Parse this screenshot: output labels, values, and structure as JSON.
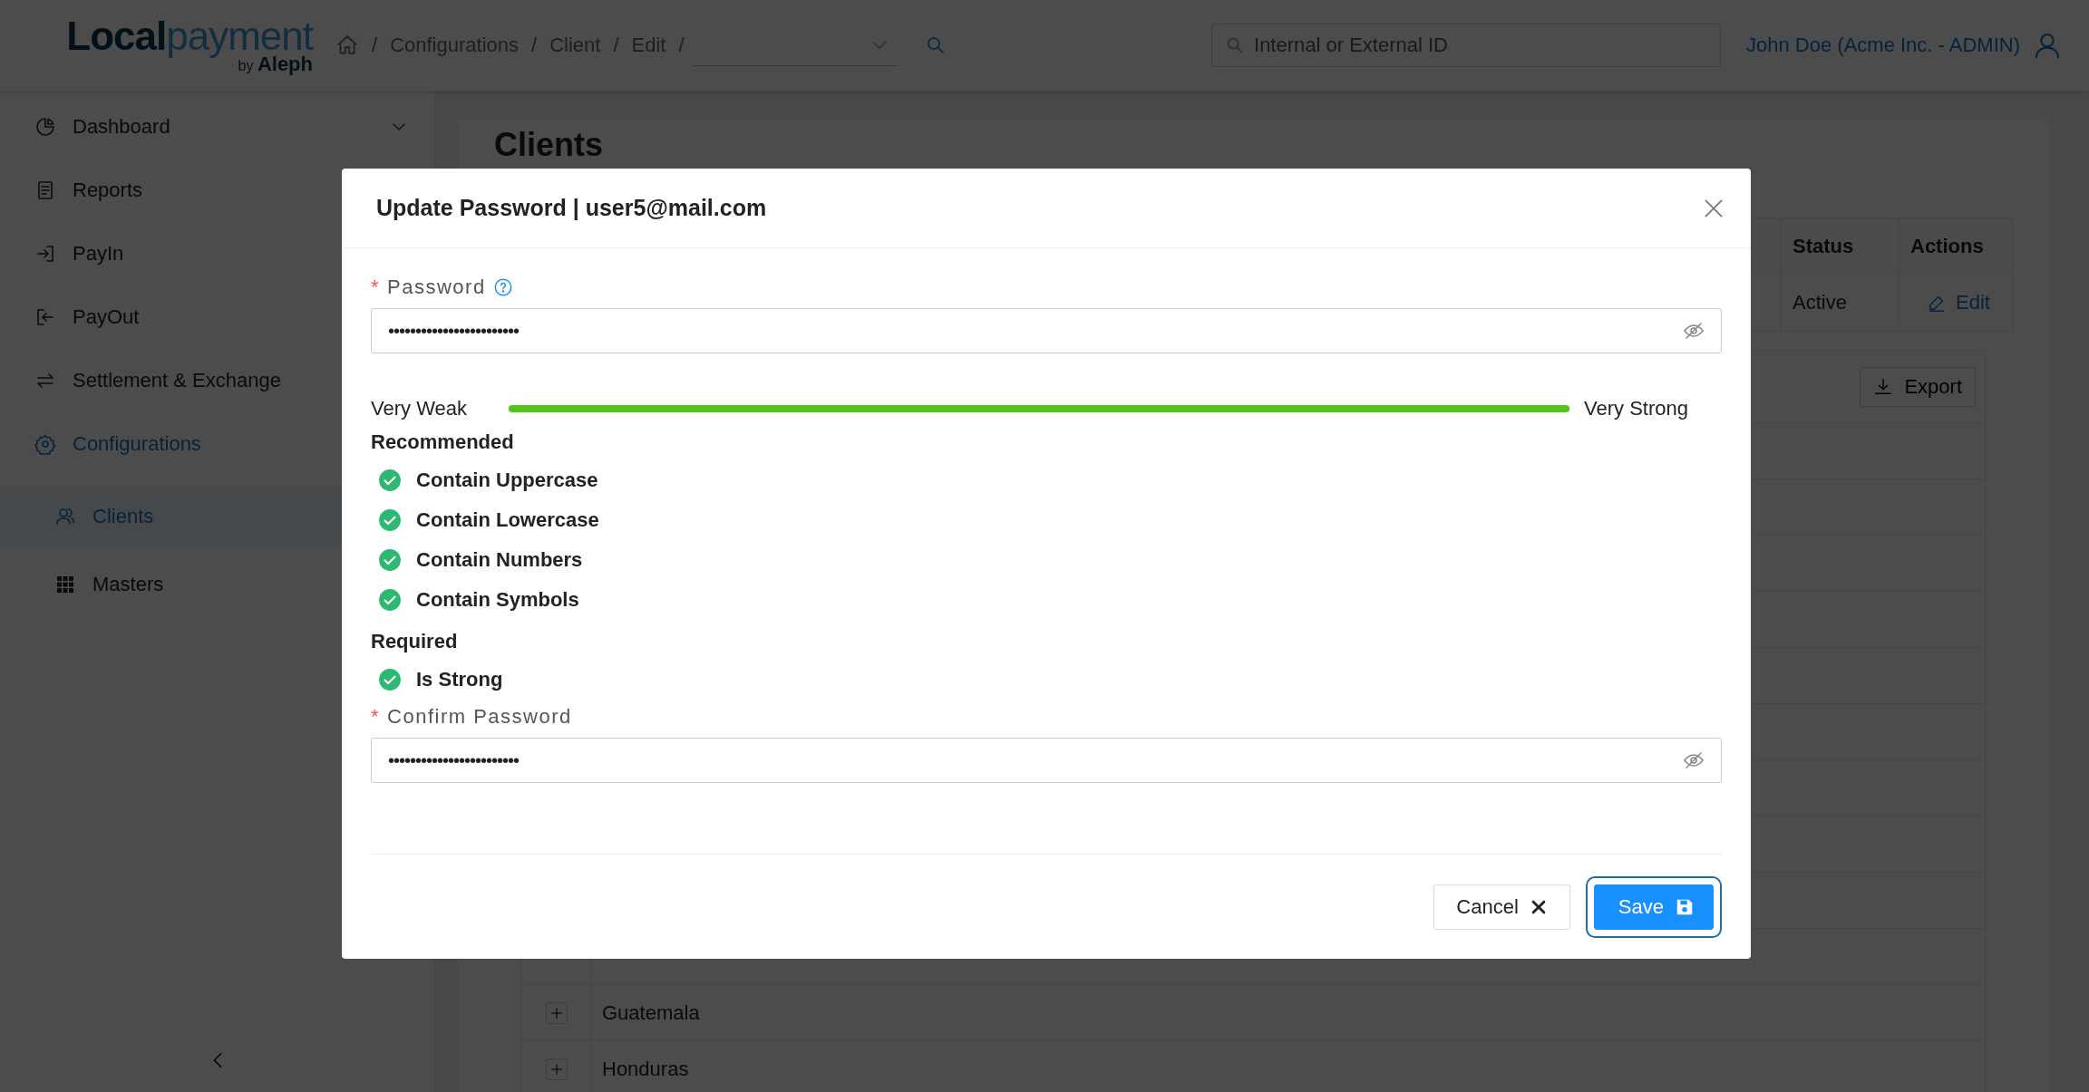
{
  "header": {
    "logo": {
      "part1": "Local",
      "part2": "payment",
      "by": "by",
      "brand": "Aleph"
    },
    "breadcrumb": {
      "separator": "/",
      "items": [
        "Configurations",
        "Client",
        "Edit"
      ]
    },
    "search": {
      "placeholder": "Internal or External ID"
    },
    "user": "John Doe (Acme Inc. - ADMIN)"
  },
  "sidebar": {
    "items": [
      {
        "label": "Dashboard",
        "selected": false,
        "expanded": false
      },
      {
        "label": "Reports",
        "selected": false
      },
      {
        "label": "PayIn",
        "selected": false
      },
      {
        "label": "PayOut",
        "selected": false
      },
      {
        "label": "Settlement & Exchange",
        "selected": false
      },
      {
        "label": "Configurations",
        "selected": true,
        "children": [
          {
            "label": "Clients",
            "selected": true
          },
          {
            "label": "Masters",
            "selected": false
          }
        ]
      }
    ]
  },
  "content": {
    "title": "Clients",
    "table": {
      "columns": [
        "Status",
        "Actions"
      ],
      "rows": [
        {
          "status": "Active",
          "action": "Edit"
        }
      ]
    },
    "export_button": "Export",
    "countries": [
      {
        "name": "Guatemala",
        "expanded": false
      },
      {
        "name": "Honduras",
        "expanded": false
      }
    ]
  },
  "modal": {
    "title": "Update Password | user5@mail.com",
    "fields": [
      {
        "label": "Password",
        "required": true,
        "help": true,
        "value": "••••••••••••••••••••••••"
      },
      {
        "label": "Confirm Password",
        "required": true,
        "help": false,
        "value": "••••••••••••••••••••••••"
      }
    ],
    "required_mark": "*",
    "strength": {
      "min_label": "Very Weak",
      "max_label": "Very Strong",
      "level": 1
    },
    "rule_groups": [
      {
        "title": "Recommended",
        "rules": [
          {
            "label": "Contain Uppercase",
            "met": true
          },
          {
            "label": "Contain Lowercase",
            "met": true
          },
          {
            "label": "Contain Numbers",
            "met": true
          },
          {
            "label": "Contain Symbols",
            "met": true
          }
        ]
      },
      {
        "title": "Required",
        "rules": [
          {
            "label": "Is Strong",
            "met": true
          }
        ]
      }
    ],
    "buttons": [
      {
        "label": "Cancel",
        "kind": "default",
        "focused": false
      },
      {
        "label": "Save",
        "kind": "primary",
        "focused": true
      }
    ]
  }
}
